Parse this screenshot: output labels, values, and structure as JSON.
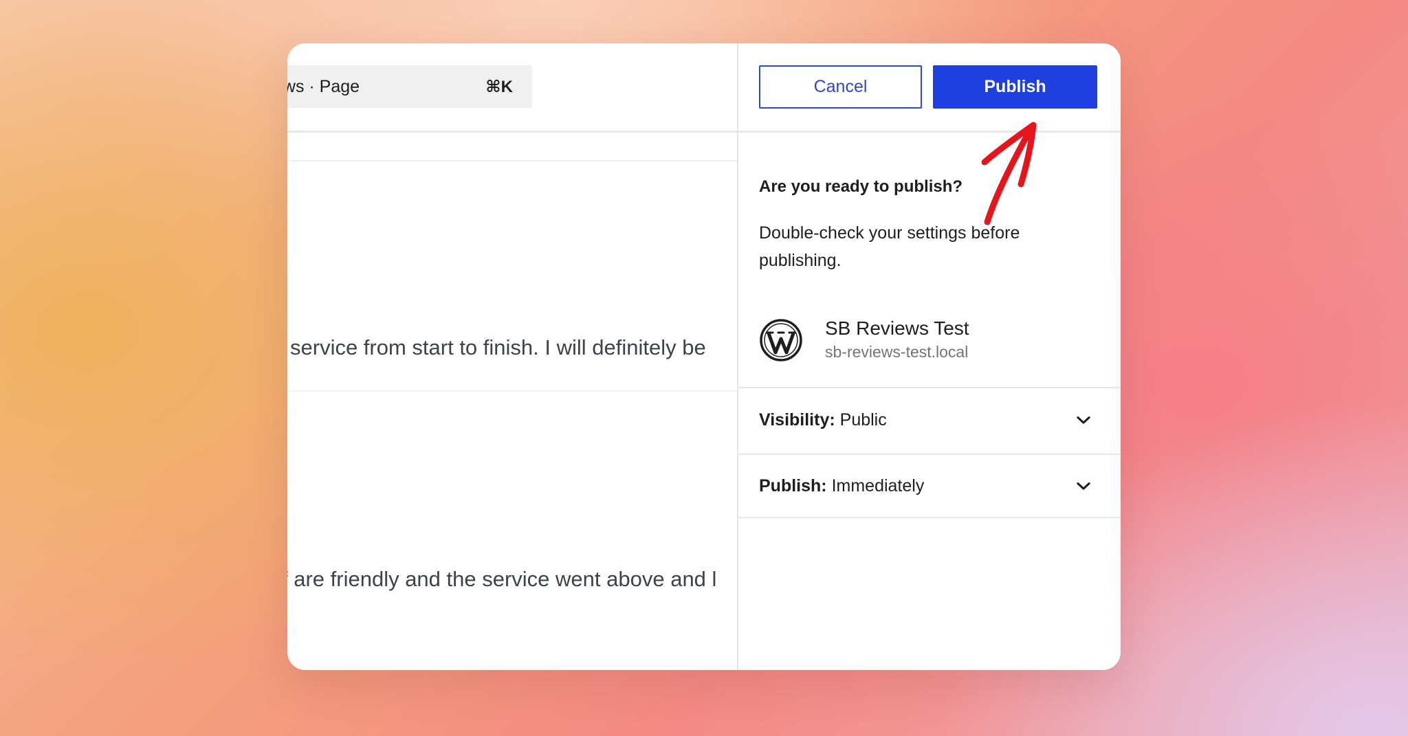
{
  "editor": {
    "command_bar": {
      "title": "ews · Page",
      "shortcut": "⌘K"
    },
    "paragraphs": [
      "service from start to finish. I will definitely be",
      "f are friendly and the service went above and l"
    ]
  },
  "publish_panel": {
    "cancel_label": "Cancel",
    "publish_label": "Publish",
    "ready_title": "Are you ready to publish?",
    "ready_description": "Double-check your settings before publishing.",
    "site": {
      "logo_icon": "wordpress-logo-icon",
      "name": "SB Reviews Test",
      "url": "sb-reviews-test.local"
    },
    "visibility": {
      "label": "Visibility:",
      "value": "Public"
    },
    "publish_time": {
      "label": "Publish:",
      "value": "Immediately"
    }
  },
  "annotation": {
    "icon": "red-arrow-icon",
    "color": "#e8141b"
  },
  "colors": {
    "accent": "#1f40de",
    "cancel_border": "#2d49d4"
  }
}
